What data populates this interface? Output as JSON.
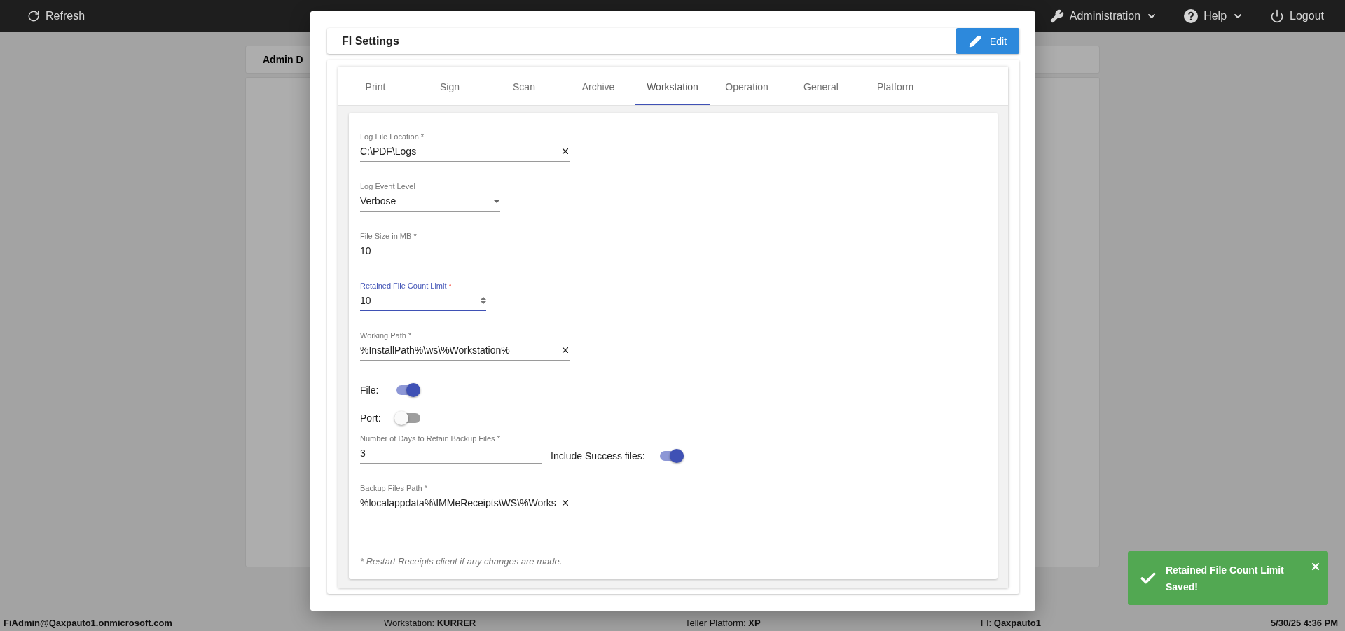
{
  "top_bar": {
    "left": [
      {
        "kind": "refresh",
        "label": "Refresh"
      }
    ],
    "right": [
      {
        "kind": "admin",
        "label": "Administration",
        "dropdown": true
      },
      {
        "kind": "help",
        "label": "Help",
        "dropdown": true
      },
      {
        "kind": "logout",
        "label": "Logout",
        "dropdown": false
      }
    ]
  },
  "background_card": {
    "title": "Admin D"
  },
  "dialog": {
    "title": "FI Settings",
    "edit_button": "Edit",
    "tabs": [
      {
        "label": "Print",
        "selected": false
      },
      {
        "label": "Sign",
        "selected": false
      },
      {
        "label": "Scan",
        "selected": false
      },
      {
        "label": "Archive",
        "selected": false
      },
      {
        "label": "Workstation",
        "selected": true
      },
      {
        "label": "Operation",
        "selected": false
      },
      {
        "label": "General",
        "selected": false
      },
      {
        "label": "Platform",
        "selected": false
      }
    ],
    "fields": [
      {
        "kind": "text",
        "label": "Log File Location",
        "asterisk": "*",
        "value": "C:\\PDF\\Logs",
        "clearable": true,
        "focused": false
      },
      {
        "kind": "select",
        "label": "Log Event Level",
        "value": "Verbose",
        "focused": false
      },
      {
        "kind": "text",
        "label": "File Size in MB",
        "asterisk": "*",
        "value": "10",
        "clearable": false,
        "focused": false
      },
      {
        "kind": "number",
        "label": "Retained File Count Limit",
        "asterisk": "*",
        "value": "10",
        "focused": true
      },
      {
        "kind": "text",
        "label": "Working Path",
        "asterisk": "*",
        "value": "%InstallPath%\\ws\\%Workstation%",
        "clearable": true,
        "focused": false
      },
      {
        "kind": "toggle",
        "label": "File:",
        "on": true
      },
      {
        "kind": "toggle",
        "label": "Port:",
        "on": false
      },
      {
        "kind": "text",
        "label": "Number of Days to Retain Backup Files",
        "asterisk": "*",
        "value": "3",
        "clearable": false,
        "focused": false,
        "side_toggle": {
          "label": "Include Success files:",
          "on": true
        }
      },
      {
        "kind": "text",
        "label": "Backup Files Path",
        "asterisk": "*",
        "value": "%localappdata%\\IMMeReceipts\\WS\\%Works",
        "clearable": true,
        "focused": false
      }
    ],
    "note": "* Restart Receipts client if any changes are made."
  },
  "status_bar": [
    {
      "value": "FiAdmin@Qaxpauto1.onmicrosoft.com"
    },
    {
      "label": "Workstation:",
      "value": "KURRER"
    },
    {
      "label": "Teller Platform:",
      "value": "XP"
    },
    {
      "label": "FI:",
      "value": "Qaxpauto1"
    },
    {
      "value": "5/30/25 4:36 PM"
    }
  ],
  "toast": {
    "message": "Retained File Count Limit Saved!"
  }
}
